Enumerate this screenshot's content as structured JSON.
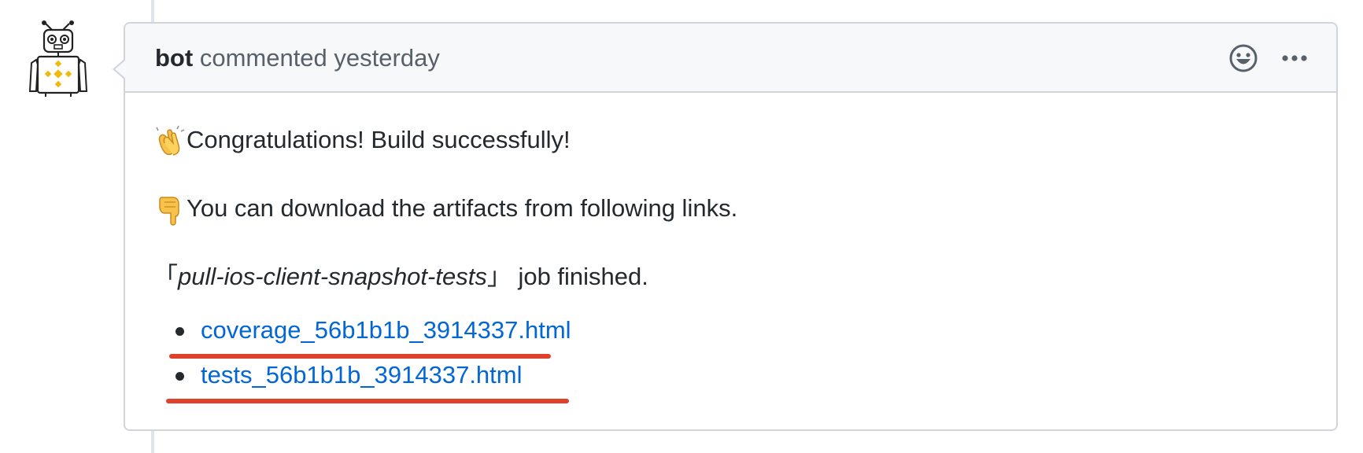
{
  "comment": {
    "author": "bot",
    "action": "commented",
    "time": "yesterday",
    "body": {
      "congrats_text": "Congratulations! Build successfully!",
      "download_text": "You can download the artifacts from following links.",
      "job_open_bracket": "「",
      "job_name": "pull-ios-client-snapshot-tests",
      "job_close_bracket": "」",
      "job_suffix": " job finished.",
      "links": [
        {
          "label": "coverage_56b1b1b_3914337.html"
        },
        {
          "label": "tests_56b1b1b_3914337.html"
        }
      ]
    }
  },
  "icons": {
    "reaction": "smiley-face-icon",
    "more": "kebab-horizontal-icon",
    "congrats_emoji": "clapping-hands-icon",
    "download_emoji": "pointing-down-hand-icon"
  },
  "colors": {
    "link": "#0366d6",
    "annotation": "#e0412b",
    "header_bg": "#f6f8fa",
    "border": "#d1d5da"
  }
}
